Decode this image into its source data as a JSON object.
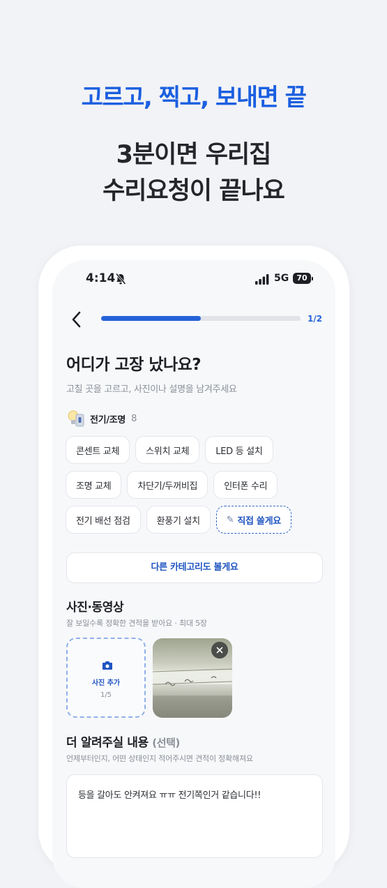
{
  "promo": {
    "headline": "고르고, 찍고, 보내면 끝",
    "subhead_line1": "3분이면 우리집",
    "subhead_line2": "수리요청이 끝나요"
  },
  "status_bar": {
    "time": "4:14",
    "network": "5G",
    "battery": "70"
  },
  "nav": {
    "progress_label": "1/2",
    "progress_fraction": 0.5
  },
  "page": {
    "title": "어디가 고장 났나요?",
    "description": "고칠 곳을 고르고, 사진이나 설명을 남겨주세요"
  },
  "category": {
    "name": "전기/조명",
    "count": "8",
    "options": [
      "콘센트 교체",
      "스위치 교체",
      "LED 등 설치",
      "조명 교체",
      "차단기/두꺼비집",
      "인터폰 수리",
      "전기 배선 점검",
      "환풍기 설치"
    ],
    "custom_option": "직접 쓸게요",
    "other_button": "다른 카테고리도 볼게요"
  },
  "photos": {
    "title": "사진·동영상",
    "description": "잘 보일수록 정확한 견적을 받아요 · 최대 5장",
    "add_label": "사진 추가",
    "count": "1/5"
  },
  "note": {
    "title": "더 알려주실 내용",
    "optional": "(선택)",
    "description": "언제부터인지, 어떤 상태인지 적어주시면 견적이 정확해져요",
    "value": "등을 갈아도 안켜져요 ㅠㅠ 전기쪽인거 같습니다!!"
  },
  "colors": {
    "accent": "#2563d9",
    "headline": "#1b5fe0",
    "background": "#f2f3f6"
  }
}
